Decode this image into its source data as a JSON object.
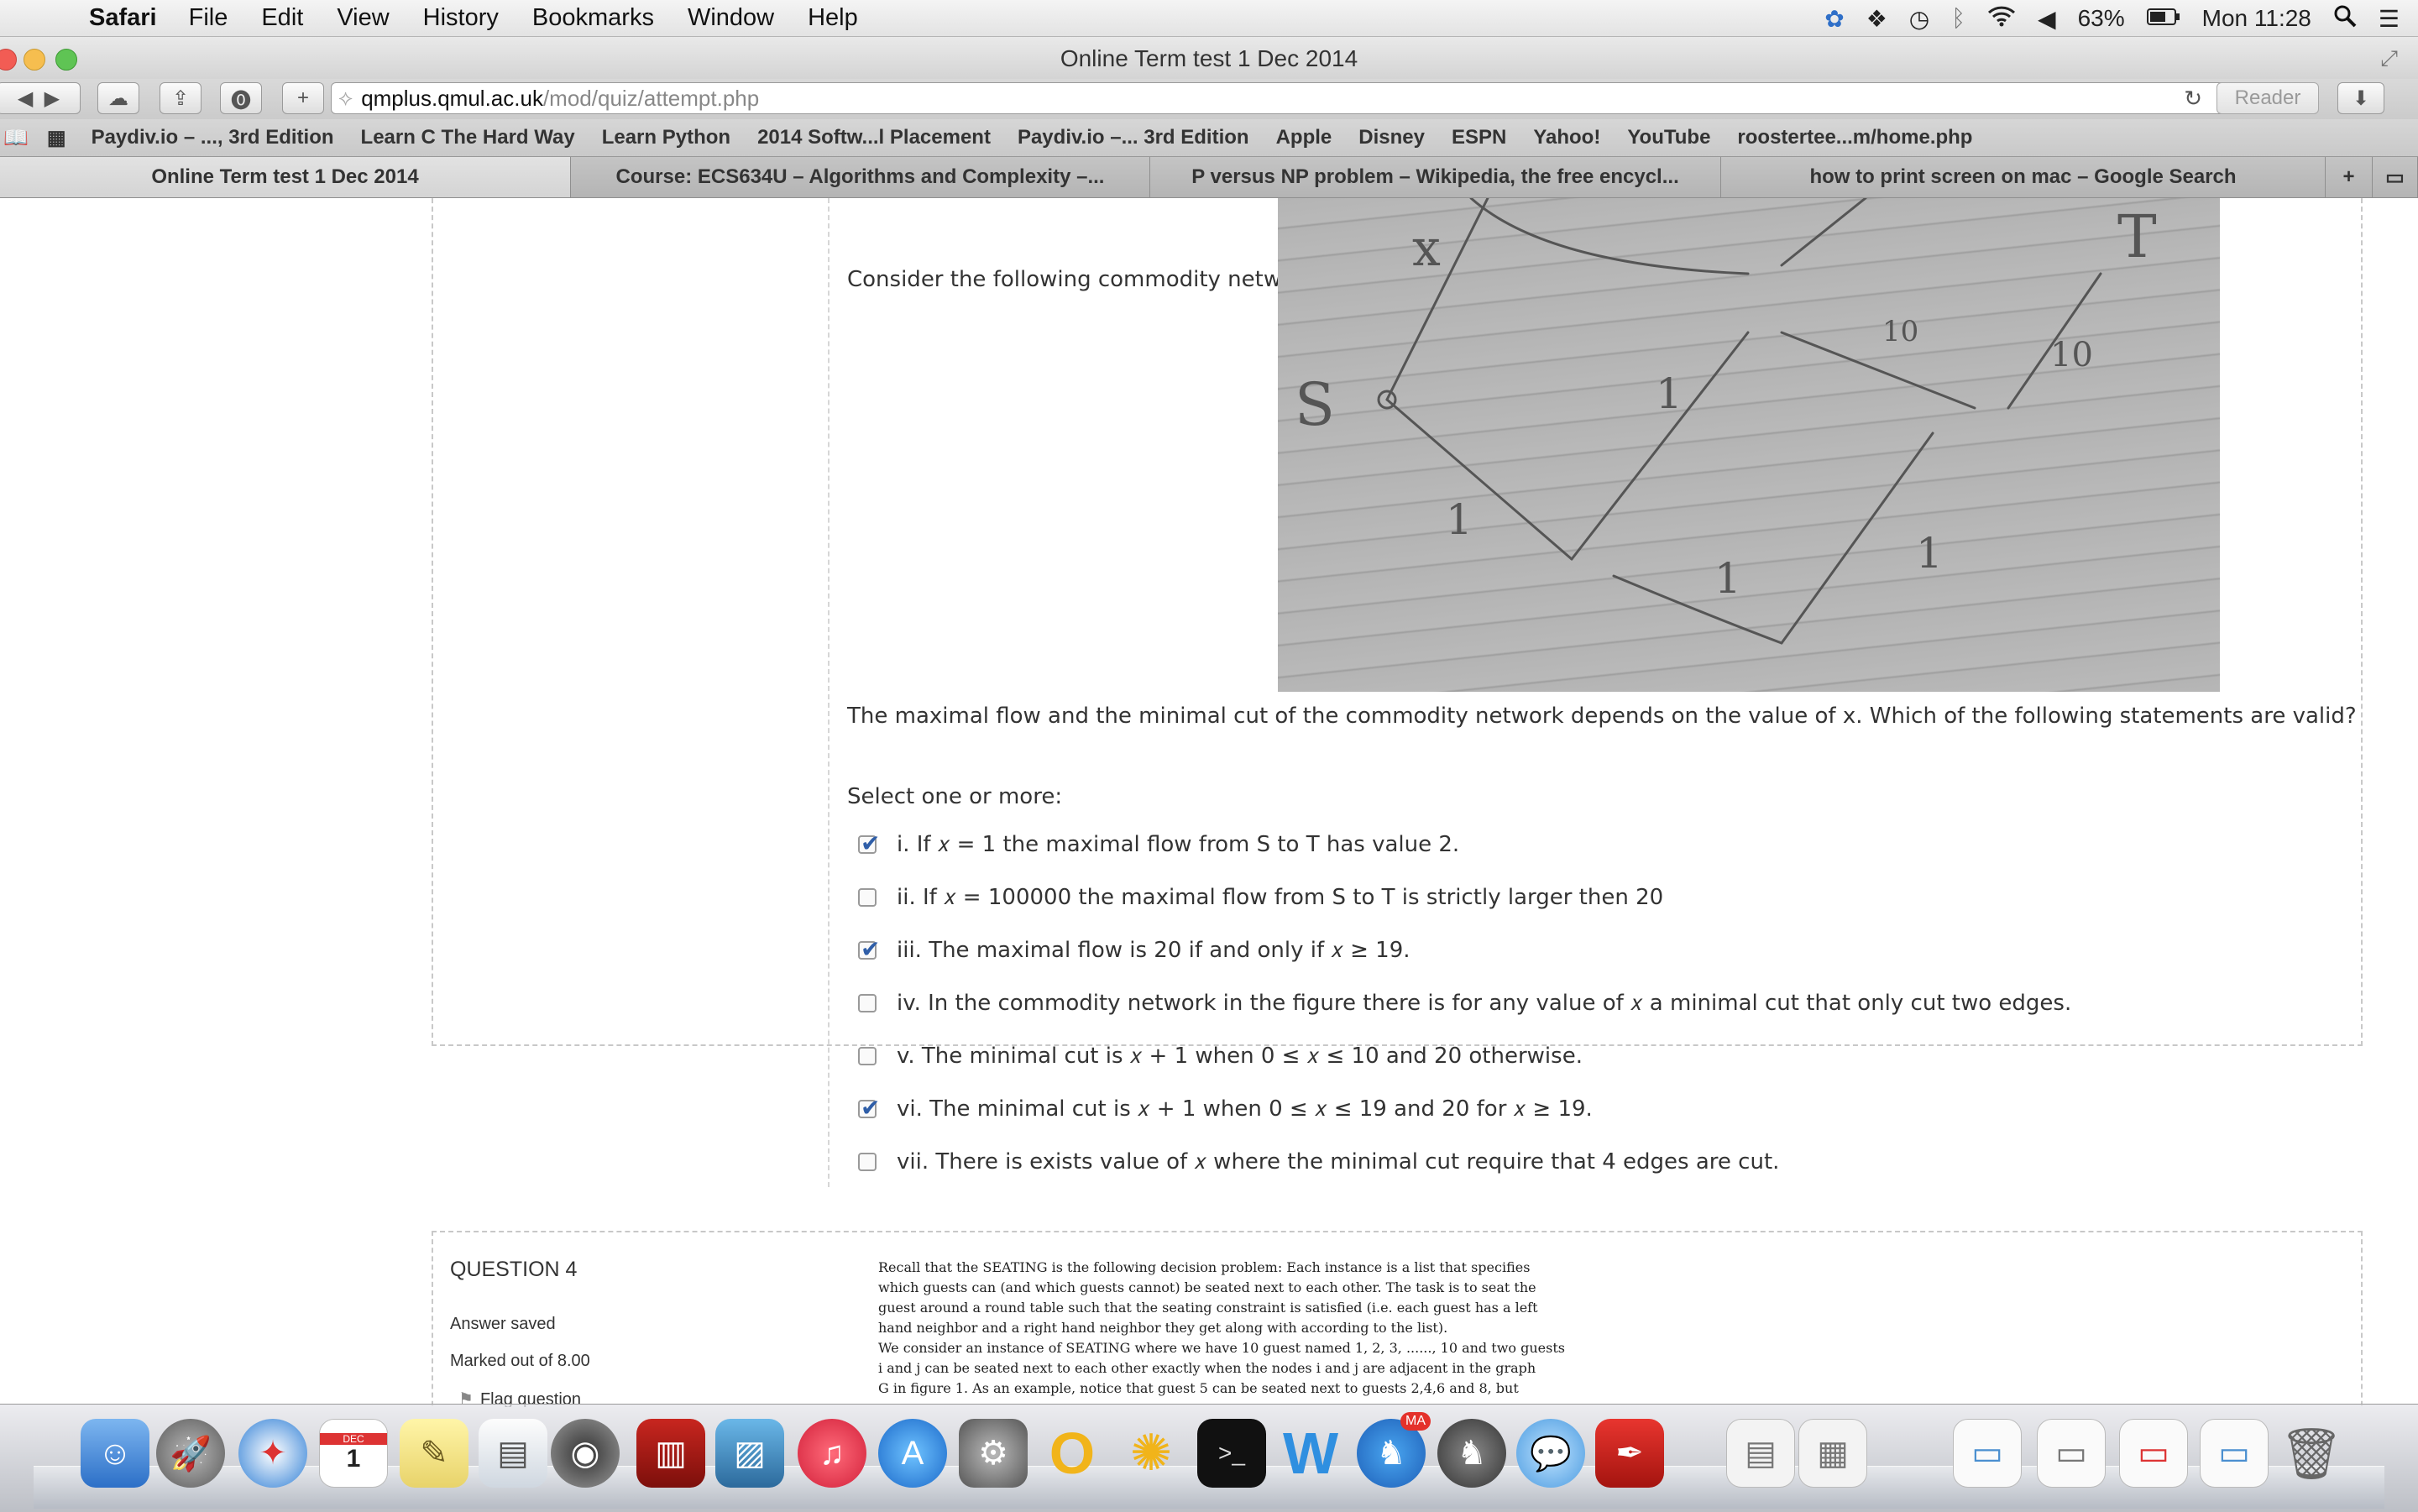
{
  "menubar": {
    "app_name": "Safari",
    "items": [
      "File",
      "Edit",
      "View",
      "History",
      "Bookmarks",
      "Window",
      "Help"
    ],
    "battery": "63%",
    "clock": "Mon 11:28"
  },
  "window": {
    "title": "Online Term test 1 Dec 2014"
  },
  "toolbar": {
    "url_host": "qmplus.qmul.ac.uk",
    "url_path": "/mod/quiz/attempt.php",
    "reader_label": "Reader"
  },
  "bookmarks": [
    "Paydiv.io – ..., 3rd Edition",
    "Learn C The Hard Way",
    "Learn Python",
    "2014 Softw...l Placement",
    "Paydiv.io –... 3rd Edition",
    "Apple",
    "Disney",
    "ESPN",
    "Yahoo!",
    "YouTube",
    "roostertee...m/home.php"
  ],
  "tabs": [
    "Online Term test 1 Dec 2014",
    "Course: ECS634U – Algorithms and Complexity –...",
    "P versus NP problem – Wikipedia, the free encycl...",
    "how to print screen on mac – Google Search"
  ],
  "question3": {
    "intro": "Consider the following commodity network.",
    "question": "The maximal flow and the minimal cut of the commodity network depends on the value of x.  Which of the following statements are valid?",
    "prompt": "Select one or more:",
    "options": [
      {
        "text": "i. If 𝑥 = 1 the maximal flow from S to T has value 2.",
        "checked": true
      },
      {
        "text": "ii. If 𝑥 = 100000 the maximal flow from S to T is strictly larger then 20",
        "checked": false
      },
      {
        "text": "iii. The maximal flow is 20 if and only if 𝑥 ≥ 19.",
        "checked": true
      },
      {
        "text": "iv. In the commodity network in the figure there is for any value of 𝑥 a minimal cut that only cut two edges.",
        "checked": false
      },
      {
        "text": "v. The minimal cut is 𝑥 + 1 when 0 ≤ 𝑥 ≤ 10 and 20 otherwise.",
        "checked": false
      },
      {
        "text": "vi. The minimal cut is 𝑥 + 1 when 0 ≤ 𝑥 ≤ 19 and 20 for 𝑥 ≥ 19.",
        "checked": true
      },
      {
        "text": "vii. There is exists value of 𝑥 where the minimal cut require that 4 edges are cut.",
        "checked": false
      }
    ],
    "sketch_labels": {
      "s": "S",
      "t": "T",
      "x": "x",
      "ten_a": "10",
      "ten_b": "10",
      "one_a": "1",
      "one_b": "1",
      "one_c": "1",
      "one_d": "1"
    }
  },
  "question4": {
    "label": "QUESTION 4",
    "state": "Answer saved",
    "mark": "Marked out of 8.00",
    "flag": "Flag question",
    "body": [
      "Recall that the SEATING is the following decision problem: Each instance is a list that specifies",
      "which guests can (and which guests cannot) be seated next to each other. The task is to seat the",
      "guest around a round table such that the seating constraint is satisfied (i.e. each guest has a left",
      "hand neighbor and a right hand neighbor they get along with according to the list).",
      "We consider an instance of SEATING where we have 10 guest named 1, 2, 3, ......, 10 and two guests",
      "i and j can be seated next to each other exactly when the nodes i and j are adjacent in the graph",
      "G in figure 1.  As an example, notice that guest 5 can be seated next to guests 2,4,6 and 8, but"
    ]
  },
  "dock": {
    "calendar_month": "DEC",
    "calendar_day": "1",
    "badge": "MA"
  }
}
